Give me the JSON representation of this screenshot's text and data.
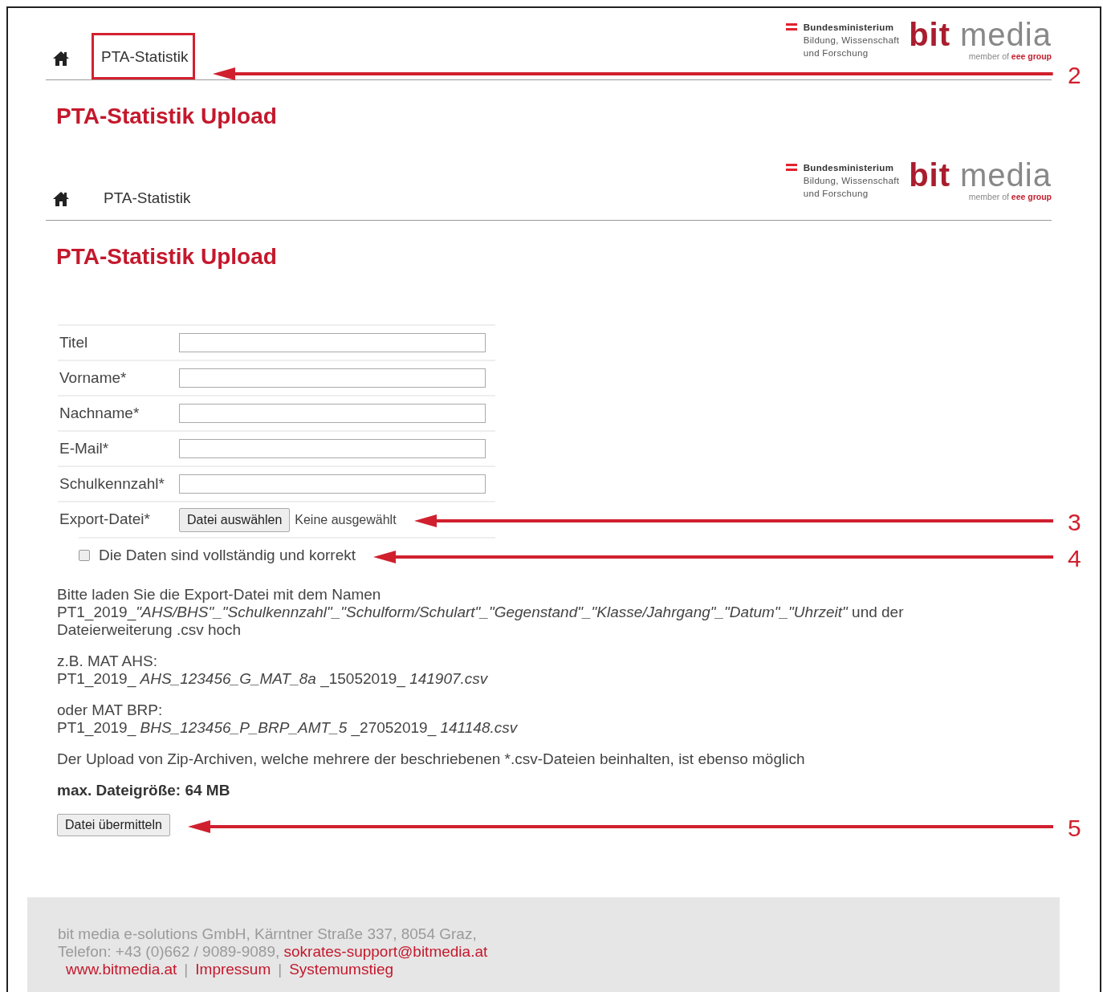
{
  "headers": [
    {
      "tab": "PTA-Statistik",
      "highlighted": true,
      "annotation": "2",
      "logo": {
        "ministry": [
          "Bundesministerium",
          "Bildung, Wissenschaft",
          "und Forschung"
        ],
        "brand_first": "bit",
        "brand_second": "media",
        "tagline": "member of",
        "tagline_group": "eee group"
      },
      "title": "PTA-Statistik Upload"
    },
    {
      "tab": "PTA-Statistik",
      "highlighted": false,
      "logo": {
        "ministry": [
          "Bundesministerium",
          "Bildung, Wissenschaft",
          "und Forschung"
        ],
        "brand_first": "bit",
        "brand_second": "media",
        "tagline": "member of",
        "tagline_group": "eee group"
      },
      "title": "PTA-Statistik Upload"
    }
  ],
  "form": {
    "fields": [
      {
        "label": "Titel",
        "kind": "text"
      },
      {
        "label": "Vorname*",
        "kind": "text"
      },
      {
        "label": "Nachname*",
        "kind": "text"
      },
      {
        "label": "E-Mail*",
        "kind": "text"
      },
      {
        "label": "Schulkennzahl*",
        "kind": "text"
      },
      {
        "label": "Export-Datei*",
        "kind": "file",
        "button": "Datei auswählen",
        "status": "Keine ausgewählt",
        "annotation": "3"
      }
    ],
    "checkbox": {
      "label": "Die Daten sind vollständig und korrekt",
      "checked": false,
      "annotation": "4"
    }
  },
  "instructions": [
    {
      "kind": "normal",
      "lines": [
        "Bitte laden Sie die Export-Datei mit dem Namen",
        [
          {
            "text": "PT1_2019_",
            "italic": false
          },
          {
            "text": "\"AHS/BHS\"_\"Schulkennzahl\"_\"Schulform/Schulart\"_\"Gegenstand\"_\"Klasse/Jahrgang\"_\"Datum\"_\"Uhrzeit\"",
            "italic": true
          },
          {
            "text": " und der",
            "italic": false
          }
        ],
        "Dateierweiterung .csv hoch"
      ]
    },
    {
      "kind": "normal",
      "lines": [
        "z.B. MAT AHS:",
        "PT1_2019_  *AHS_123456_G_MAT_8a* _15052019_ *141907.csv*"
      ]
    },
    {
      "kind": "normal",
      "lines": [
        "oder MAT BRP:",
        "PT1_2019_  *BHS_123456_P_BRP_AMT_5* _27052019_ *141148.csv*"
      ]
    },
    {
      "kind": "normal",
      "lines": [
        "Der Upload von Zip-Archiven, welche mehrere der beschriebenen *.csv-Dateien beinhalten, ist ebenso möglich"
      ]
    },
    {
      "kind": "bold",
      "lines": [
        "max. Dateigröße: 64 MB"
      ]
    }
  ],
  "submit": {
    "label": "Datei übermitteln",
    "annotation": "5"
  },
  "footer": {
    "address": "bit media e-solutions GmbH, Kärntner Straße 337, 8054 Graz,",
    "phone": "Telefon: +43 (0)662 / 9089-9089,",
    "email": "sokrates-support@bitmedia.at",
    "separator": "|",
    "links": [
      "www.bitmedia.at",
      "Impressum",
      "Systemumstieg"
    ]
  }
}
